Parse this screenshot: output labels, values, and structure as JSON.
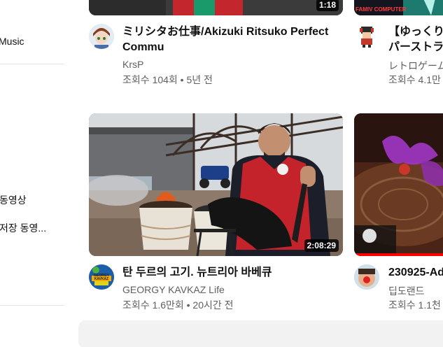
{
  "sidebar": {
    "items": [
      {
        "label": "Music"
      },
      {
        "label": "동영상"
      },
      {
        "label": "저장 동영..."
      }
    ]
  },
  "videos": [
    {
      "title_line1": "ミリシタお仕事/Akizuki Ritsuko Perfect",
      "title_line2": "Commu",
      "channel": "KrsP",
      "meta": "조회수 104회 • 5년 전",
      "duration": "1:18"
    },
    {
      "title_line1": "【ゆっくり実",
      "title_line2": "パーストラ",
      "channel": "レトロゲーム",
      "meta": "조회수 4.1만",
      "thumb_text": "FAMIV COMPUTER"
    },
    {
      "title_line1": "탄 두르의 고기. 뉴트리아 바베큐",
      "channel": "GEORGY KAVKAZ Life",
      "meta": "조회수 1.6만회 • 20시간 전",
      "duration": "2:08:29",
      "avatar_text": "GEORGY KAVKAZ"
    },
    {
      "title_line1": "230925-Ad",
      "channel": "딥도랜드",
      "meta": "조회수 1.1천"
    }
  ]
}
